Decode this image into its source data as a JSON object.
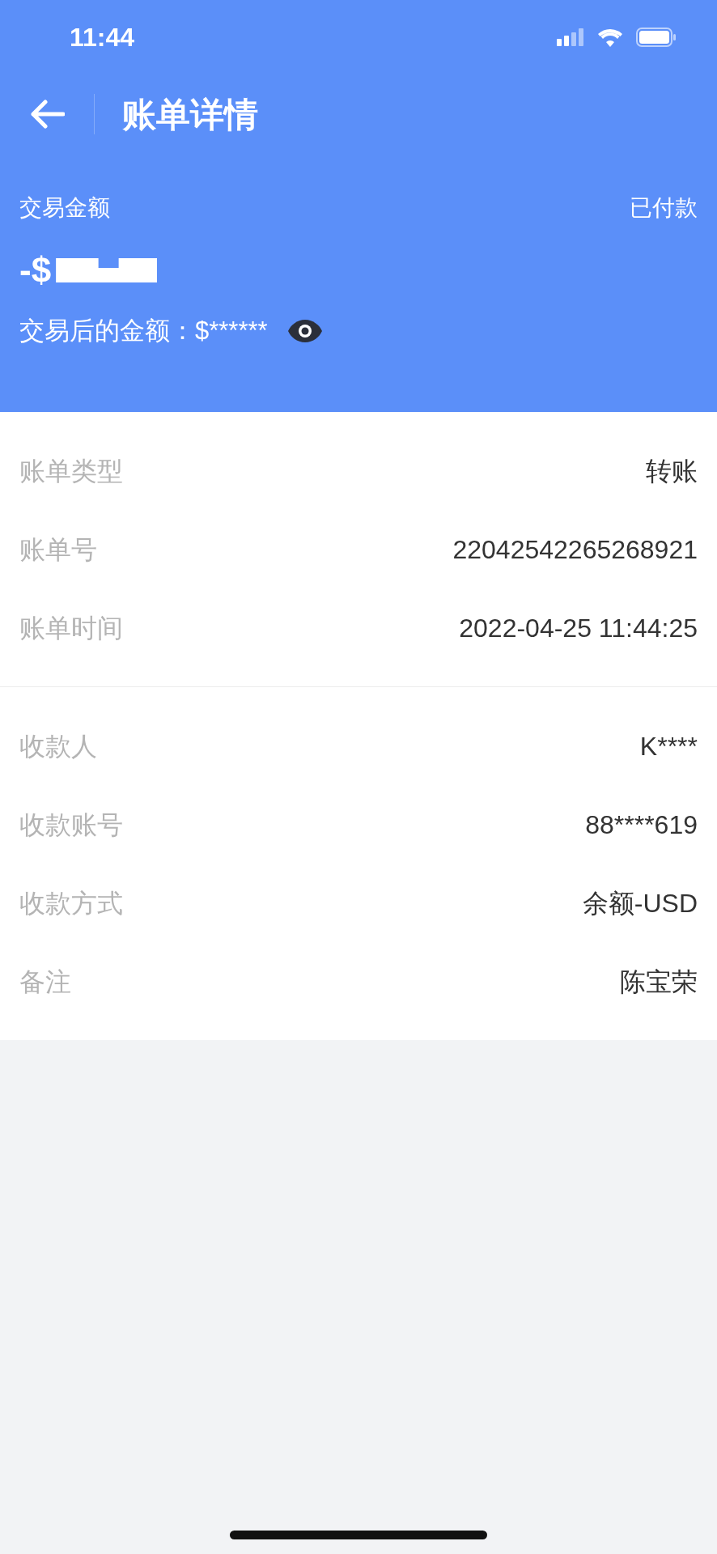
{
  "status_bar": {
    "time": "11:44"
  },
  "nav": {
    "title": "账单详情"
  },
  "summary": {
    "label": "交易金额",
    "status": "已付款",
    "amount": "-$",
    "redacted": true,
    "balance": "交易后的金额：$******"
  },
  "sections": [
    {
      "rows": [
        {
          "label": "账单类型",
          "value": "转账"
        },
        {
          "label": "账单号",
          "value": "22042542265268921"
        },
        {
          "label": "账单时间",
          "value": "2022-04-25 11:44:25"
        }
      ]
    },
    {
      "rows": [
        {
          "label": "收款人",
          "value": "K****"
        },
        {
          "label": "收款账号",
          "value": "88****619"
        },
        {
          "label": "收款方式",
          "value": "余额-USD"
        },
        {
          "label": "备注",
          "value": "陈宝荣"
        }
      ]
    }
  ]
}
